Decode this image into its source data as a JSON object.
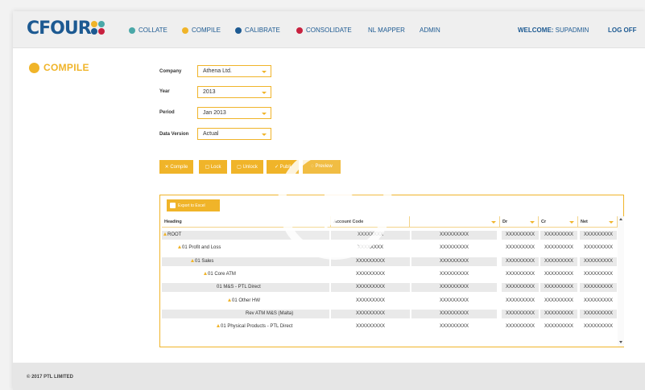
{
  "app": {
    "logo_text": "CFOUR",
    "logo_dot_colors": [
      "#f0b429",
      "#4aa8a8",
      "#1d5a92",
      "#c8213f"
    ]
  },
  "nav": {
    "items": [
      {
        "label": "COLLATE",
        "dot": "#4aa8a8"
      },
      {
        "label": "COMPILE",
        "dot": "#f0b429"
      },
      {
        "label": "CALIBRATE",
        "dot": "#1d5a92"
      },
      {
        "label": "CONSOLIDATE",
        "dot": "#c8213f"
      },
      {
        "label": "NL MAPPER",
        "dot": ""
      },
      {
        "label": "ADMIN",
        "dot": ""
      }
    ],
    "welcome_label": "WELCOME:",
    "welcome_user": "SUPADMIN",
    "logoff": "LOG OFF"
  },
  "page": {
    "title": "COMPILE",
    "accent": "#f0b429"
  },
  "form": {
    "company_label": "Company",
    "company_value": "Athena Ltd.",
    "year_label": "Year",
    "year_value": "2013",
    "period_label": "Period",
    "period_value": "Jan 2013",
    "version_label": "Data Version",
    "version_value": "Actual"
  },
  "actions": {
    "compile": "Compile",
    "lock": "Lock",
    "unlock": "Unlock",
    "publish": "Publi",
    "preview": "Preview"
  },
  "grid": {
    "export_label": "Export to Excel",
    "columns": {
      "heading": "Heading",
      "account_code": "Account Code",
      "col3": "",
      "dr": "Dr",
      "cr": "Cr",
      "net": "Net"
    },
    "rows": [
      {
        "heading": "ROOT",
        "code": "XXXXXXXX",
        "c3": "XXXXXXXXX",
        "dr": "XXXXXXXXX",
        "cr": "XXXXXXXXX",
        "net": "XXXXXXXXX"
      },
      {
        "heading": "01 Profit and Loss",
        "code": "XXXXXXXX",
        "c3": "XXXXXXXXX",
        "dr": "XXXXXXXXX",
        "cr": "XXXXXXXXX",
        "net": "XXXXXXXXX"
      },
      {
        "heading": "01 Sales",
        "code": "XXXXXXXXX",
        "c3": "XXXXXXXXX",
        "dr": "XXXXXXXXX",
        "cr": "XXXXXXXXX",
        "net": "XXXXXXXXX"
      },
      {
        "heading": "01 Core ATM",
        "code": "XXXXXXXXX",
        "c3": "XXXXXXXXX",
        "dr": "XXXXXXXXX",
        "cr": "XXXXXXXXX",
        "net": "XXXXXXXXX"
      },
      {
        "heading": "01 M&S - PTL Direct",
        "code": "XXXXXXXXX",
        "c3": "XXXXXXXXX",
        "dr": "XXXXXXXXX",
        "cr": "XXXXXXXXX",
        "net": "XXXXXXXXX"
      },
      {
        "heading": "01 Other HW",
        "code": "XXXXXXXXX",
        "c3": "XXXXXXXXX",
        "dr": "XXXXXXXXX",
        "cr": "XXXXXXXXX",
        "net": "XXXXXXXXX"
      },
      {
        "heading": "Rev ATM M&S (Malta)",
        "code": "XXXXXXXXX",
        "c3": "XXXXXXXXX",
        "dr": "XXXXXXXXX",
        "cr": "XXXXXXXXX",
        "net": "XXXXXXXXX"
      },
      {
        "heading": "01 Physical Products - PTL Direct",
        "code": "XXXXXXXXX",
        "c3": "XXXXXXXXX",
        "dr": "XXXXXXXXX",
        "cr": "XXXXXXXXX",
        "net": "XXXXXXXXX"
      }
    ]
  },
  "footer": {
    "copyright": "© 2017 PTL LIMITED"
  },
  "overlay": {
    "icon": "play-icon"
  }
}
